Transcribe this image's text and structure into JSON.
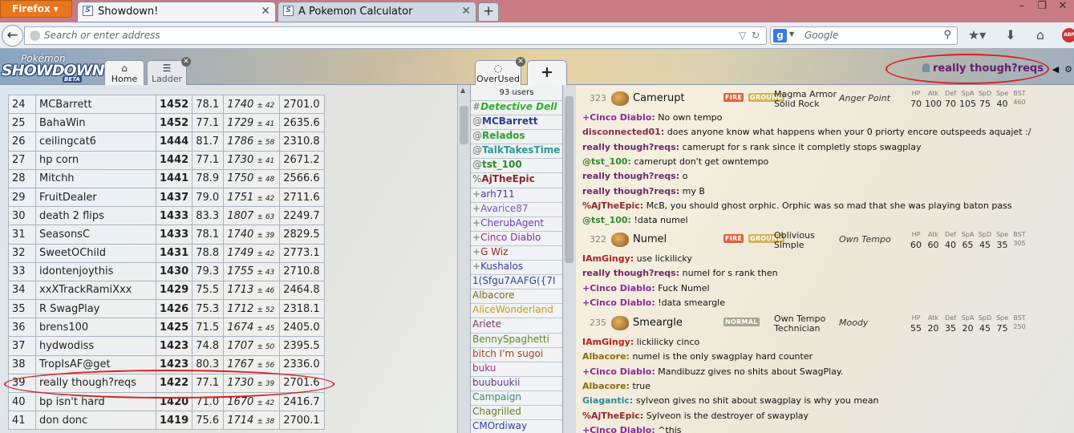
{
  "browser": {
    "menu_label": "Firefox",
    "tabs": [
      {
        "label": "Showdown!",
        "icon": "S"
      },
      {
        "label": "A Pokemon Calculator",
        "icon": "S"
      }
    ],
    "new_tab": "+",
    "win_controls": [
      "–",
      "❐",
      "✕"
    ],
    "address_placeholder": "Search or enter address",
    "search_engine_letter": "g",
    "search_placeholder": "Google",
    "adblock_label": "ABP"
  },
  "header": {
    "logo": {
      "line1": "Pokémon",
      "line2": "SHOWDOWN",
      "badge": "BETA"
    },
    "tabs": {
      "home": "Home",
      "ladder": "Ladder",
      "room": "OverUsed",
      "add": "+"
    },
    "username": "really though?reqs",
    "icons": [
      "◀",
      "⚙"
    ]
  },
  "ladder": {
    "rows": [
      [
        "24",
        "MCBarrett",
        "1452",
        "78.1",
        "1740",
        "± 42",
        "2701.0"
      ],
      [
        "25",
        "BahaWin",
        "1452",
        "77.1",
        "1729",
        "± 41",
        "2635.6"
      ],
      [
        "26",
        "ceilingcat6",
        "1444",
        "81.7",
        "1786",
        "± 58",
        "2310.8"
      ],
      [
        "27",
        "hp corn",
        "1442",
        "77.1",
        "1730",
        "± 41",
        "2671.2"
      ],
      [
        "28",
        "Mitchh",
        "1441",
        "78.9",
        "1750",
        "± 48",
        "2566.6"
      ],
      [
        "29",
        "FruitDealer",
        "1437",
        "79.0",
        "1751",
        "± 42",
        "2711.6"
      ],
      [
        "30",
        "death 2 flips",
        "1433",
        "83.3",
        "1807",
        "± 63",
        "2249.7"
      ],
      [
        "31",
        "SeasonsC",
        "1433",
        "78.1",
        "1740",
        "± 39",
        "2829.5"
      ],
      [
        "32",
        "SweetOChild",
        "1431",
        "78.8",
        "1749",
        "± 42",
        "2773.1"
      ],
      [
        "33",
        "idontenjoythis",
        "1430",
        "79.3",
        "1755",
        "± 43",
        "2710.8"
      ],
      [
        "34",
        "xxXTrackRamiXxx",
        "1429",
        "75.5",
        "1713",
        "± 46",
        "2464.8"
      ],
      [
        "35",
        "R SwagPlay",
        "1426",
        "75.3",
        "1712",
        "± 52",
        "2318.1"
      ],
      [
        "36",
        "brens100",
        "1425",
        "71.5",
        "1674",
        "± 45",
        "2405.0"
      ],
      [
        "37",
        "hydwodiss",
        "1423",
        "74.8",
        "1707",
        "± 50",
        "2395.5"
      ],
      [
        "38",
        "TropIsAF@get",
        "1423",
        "80.3",
        "1767",
        "± 56",
        "2336.0"
      ],
      [
        "39",
        "really though?reqs",
        "1422",
        "77.1",
        "1730",
        "± 39",
        "2701.6"
      ],
      [
        "40",
        "bp isn't hard",
        "1420",
        "71.0",
        "1670",
        "± 42",
        "2416.7"
      ],
      [
        "41",
        "don donc",
        "1419",
        "75.6",
        "1714",
        "± 38",
        "2700.1"
      ]
    ]
  },
  "userlist": {
    "count": "93 users",
    "users": [
      {
        "rank": "#",
        "name": "Detective Dell",
        "color": "#2fae2a",
        "bold": true,
        "italic": true
      },
      {
        "rank": "@",
        "name": "MCBarrett",
        "color": "#2e3d8a",
        "bold": true
      },
      {
        "rank": "@",
        "name": "Relados",
        "color": "#2fa02a",
        "bold": true
      },
      {
        "rank": "@",
        "name": "TalkTakesTime",
        "color": "#2a9a93",
        "bold": true
      },
      {
        "rank": "@",
        "name": "tst_100",
        "color": "#2e8b2e",
        "bold": true
      },
      {
        "rank": "%",
        "name": "AjTheEpic",
        "color": "#8a2b2b",
        "bold": true
      },
      {
        "rank": "+",
        "name": "arh711",
        "color": "#4c3aa0"
      },
      {
        "rank": "+",
        "name": "Avarice87",
        "color": "#7d5bb0"
      },
      {
        "rank": "+",
        "name": "CherubAgent",
        "color": "#6b3fb0"
      },
      {
        "rank": "+",
        "name": "Cinco Diablo",
        "color": "#8a2b9a"
      },
      {
        "rank": "+",
        "name": "G Wiz",
        "color": "#a02020"
      },
      {
        "rank": "+",
        "name": "Kushalos",
        "color": "#3040a0"
      },
      {
        "rank": "",
        "name": "1(Sfgu7AAFG({7I",
        "color": "#3040a0"
      },
      {
        "rank": "",
        "name": "Albacore",
        "color": "#7a6a20"
      },
      {
        "rank": "",
        "name": "AliceWonderland",
        "color": "#c0a020"
      },
      {
        "rank": "",
        "name": "Ariete",
        "color": "#7a3a60"
      },
      {
        "rank": "",
        "name": "BennySpaghetti",
        "color": "#5a8a20"
      },
      {
        "rank": "",
        "name": "bitch I'm sugoi",
        "color": "#a04020"
      },
      {
        "rank": "",
        "name": "buku",
        "color": "#9a3080"
      },
      {
        "rank": "",
        "name": "buubuukii",
        "color": "#5a3aa0"
      },
      {
        "rank": "",
        "name": "Campaign",
        "color": "#3a8a6a"
      },
      {
        "rank": "",
        "name": "Chagrilled",
        "color": "#6a7a20"
      },
      {
        "rank": "",
        "name": "CMOrdiway",
        "color": "#3040a0"
      }
    ]
  },
  "chat": {
    "messages": [
      {
        "user": "+Cinco Diablo:",
        "color": "#8a2b9a",
        "text": "No own tempo"
      },
      {
        "user": "disconnected01:",
        "color": "#8a2b48",
        "text": "does anyone know what happens when your 0 priorty encore outspeeds aquajet :/"
      },
      {
        "user": "really though?reqs:",
        "color": "#6a2a6a",
        "text": "camerupt for s rank since it completly stops swagplay"
      },
      {
        "user": "@tst_100:",
        "color": "#2e8b2e",
        "text": "camerupt don't get owntempo"
      },
      {
        "user": "really though?reqs:",
        "color": "#6a2a6a",
        "text": "o"
      },
      {
        "user": "really though?reqs:",
        "color": "#6a2a6a",
        "text": "my B"
      },
      {
        "user": "%AjTheEpic:",
        "color": "#8a2b2b",
        "text": "McB, you should ghost orphic. Orphic was so mad that she was playing baton pass"
      },
      {
        "user": "@tst_100:",
        "color": "#2e8b2e",
        "text": "!data numel"
      },
      {
        "user": "IAmGingy:",
        "color": "#b02020",
        "text": "use lickilicky"
      },
      {
        "user": "really though?reqs:",
        "color": "#6a2a6a",
        "text": "numel for s rank then"
      },
      {
        "user": "+Cinco Diablo:",
        "color": "#8a2b9a",
        "text": "Fuck Numel"
      },
      {
        "user": "+Cinco Diablo:",
        "color": "#8a2b9a",
        "text": "!data smeargle"
      },
      {
        "user": "IAmGingy:",
        "color": "#b02020",
        "text": "lickilicky cinco"
      },
      {
        "user": "Albacore:",
        "color": "#8a6a10",
        "text": "numel is the only swagplay hard counter"
      },
      {
        "user": "+Cinco Diablo:",
        "color": "#8a2b9a",
        "text": "Mandibuzz gives no shits about SwagPlay."
      },
      {
        "user": "Albacore:",
        "color": "#8a6a10",
        "text": "true"
      },
      {
        "user": "Giagantic:",
        "color": "#2a8a9a",
        "text": "sylveon gives no shit about swagplay is why you mean"
      },
      {
        "user": "%AjTheEpic:",
        "color": "#8a2b2b",
        "text": "Sylveon is the destroyer of swayplay"
      },
      {
        "user": "+Cinco Diablo:",
        "color": "#8a2b9a",
        "text": "^this"
      }
    ],
    "stat_labels": [
      "HP",
      "Atk",
      "Def",
      "SpA",
      "SpD",
      "Spe",
      "BST"
    ],
    "pokemon": [
      {
        "num": "323",
        "name": "Camerupt",
        "types": [
          {
            "t": "FIRE",
            "c": "#e0603a"
          },
          {
            "t": "GROUND",
            "c": "#d4b45a"
          }
        ],
        "abilities": [
          "Magma Armor",
          "Solid Rock"
        ],
        "hidden": "Anger Point",
        "stats": [
          "70",
          "100",
          "70",
          "105",
          "75",
          "40",
          "460"
        ]
      },
      {
        "num": "322",
        "name": "Numel",
        "types": [
          {
            "t": "FIRE",
            "c": "#e0603a"
          },
          {
            "t": "GROUND",
            "c": "#d4b45a"
          }
        ],
        "abilities": [
          "Oblivious",
          "Simple"
        ],
        "hidden": "Own Tempo",
        "stats": [
          "60",
          "60",
          "40",
          "65",
          "45",
          "35",
          "305"
        ]
      },
      {
        "num": "235",
        "name": "Smeargle",
        "types": [
          {
            "t": "NORMAL",
            "c": "#a8a690"
          }
        ],
        "abilities": [
          "Own Tempo",
          "Technician"
        ],
        "hidden": "Moody",
        "stats": [
          "55",
          "20",
          "35",
          "20",
          "45",
          "75",
          "250"
        ]
      }
    ]
  }
}
